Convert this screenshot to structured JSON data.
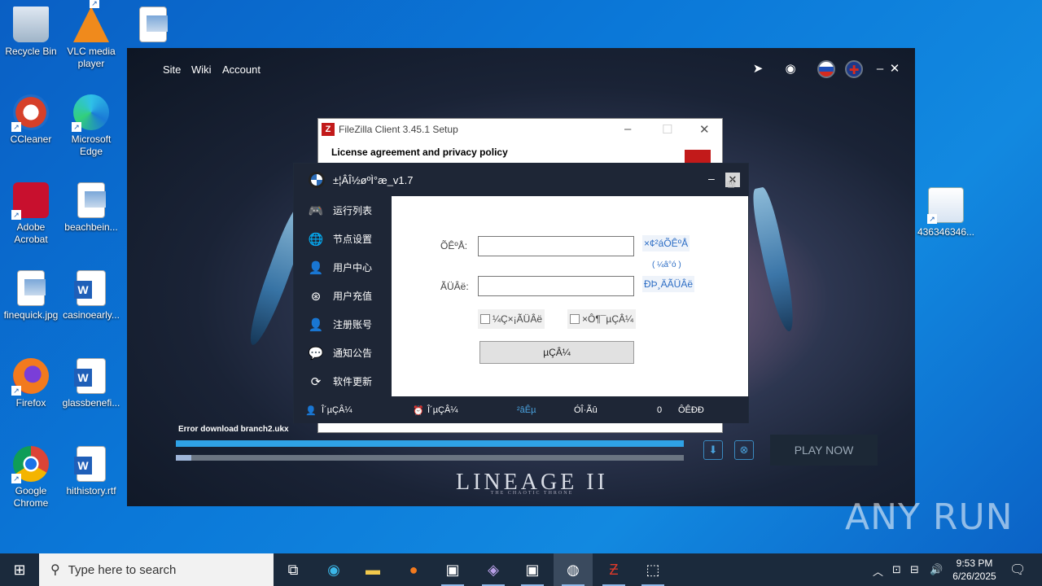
{
  "desktop": {
    "icons": [
      {
        "label": "Recycle Bin"
      },
      {
        "label": "VLC media player"
      },
      {
        "label": "CCleaner"
      },
      {
        "label": "Microsoft Edge"
      },
      {
        "label": "Adobe Acrobat"
      },
      {
        "label": "beachbein..."
      },
      {
        "label": "finequick.jpg"
      },
      {
        "label": "casinoearly..."
      },
      {
        "label": "Firefox"
      },
      {
        "label": "glassbenefi..."
      },
      {
        "label": "Google Chrome"
      },
      {
        "label": "hithistory.rtf"
      },
      {
        "label": "436346346..."
      }
    ]
  },
  "launcher": {
    "nav": {
      "site": "Site",
      "wiki": "Wiki",
      "account": "Account"
    },
    "error_text": "Error download branch2.ukx",
    "play_label": "PLAY NOW",
    "logo": "LINEAGE II",
    "logo_sub": "THE CHAOTIC THRONE",
    "progress": {
      "download": 1.0,
      "overall": 0.03
    }
  },
  "filezilla": {
    "title": "FileZilla Client 3.45.1 Setup",
    "heading": "License agreement and privacy policy"
  },
  "app": {
    "title": "±¦ÂÎ½øºÌ°æ_v1.7",
    "sidebar": [
      {
        "label": "运行列表",
        "icon": "gamepad-icon"
      },
      {
        "label": "节点设置",
        "icon": "globe-icon"
      },
      {
        "label": "用户中心",
        "icon": "user-icon"
      },
      {
        "label": "用户充值",
        "icon": "recharge-icon"
      },
      {
        "label": "注册账号",
        "icon": "add-user-icon"
      },
      {
        "label": "通知公告",
        "icon": "wechat-icon"
      },
      {
        "label": "软件更新",
        "icon": "refresh-icon"
      }
    ],
    "form": {
      "account_label": "ÕÊºÅ:",
      "password_label": "ÃÜÂë:",
      "account_value": "",
      "password_value": "",
      "register_link": "×¢²áÕÊºÅ",
      "register_sub": "( ¼â°ó )",
      "change_pw_link": "ÐÞ¸ÄÃÜÂë",
      "remember_label": "¼Ç×¡ÃÜÂë",
      "autologin_label": "×Ô¶¯µÇÂ¼",
      "login_button": "µÇÂ¼"
    },
    "status": {
      "user": "Î´µÇÂ¼",
      "time": "Î´µÇÂ¼",
      "points_label": "²âÊµ",
      "online_label": "ÓÎ·Ãû",
      "count": "0",
      "state": "ÔÊÐÐ"
    }
  },
  "watermark": "ANY RUN",
  "taskbar": {
    "search_placeholder": "Type here to search",
    "time": "9:53 PM",
    "date": "6/26/2025"
  }
}
